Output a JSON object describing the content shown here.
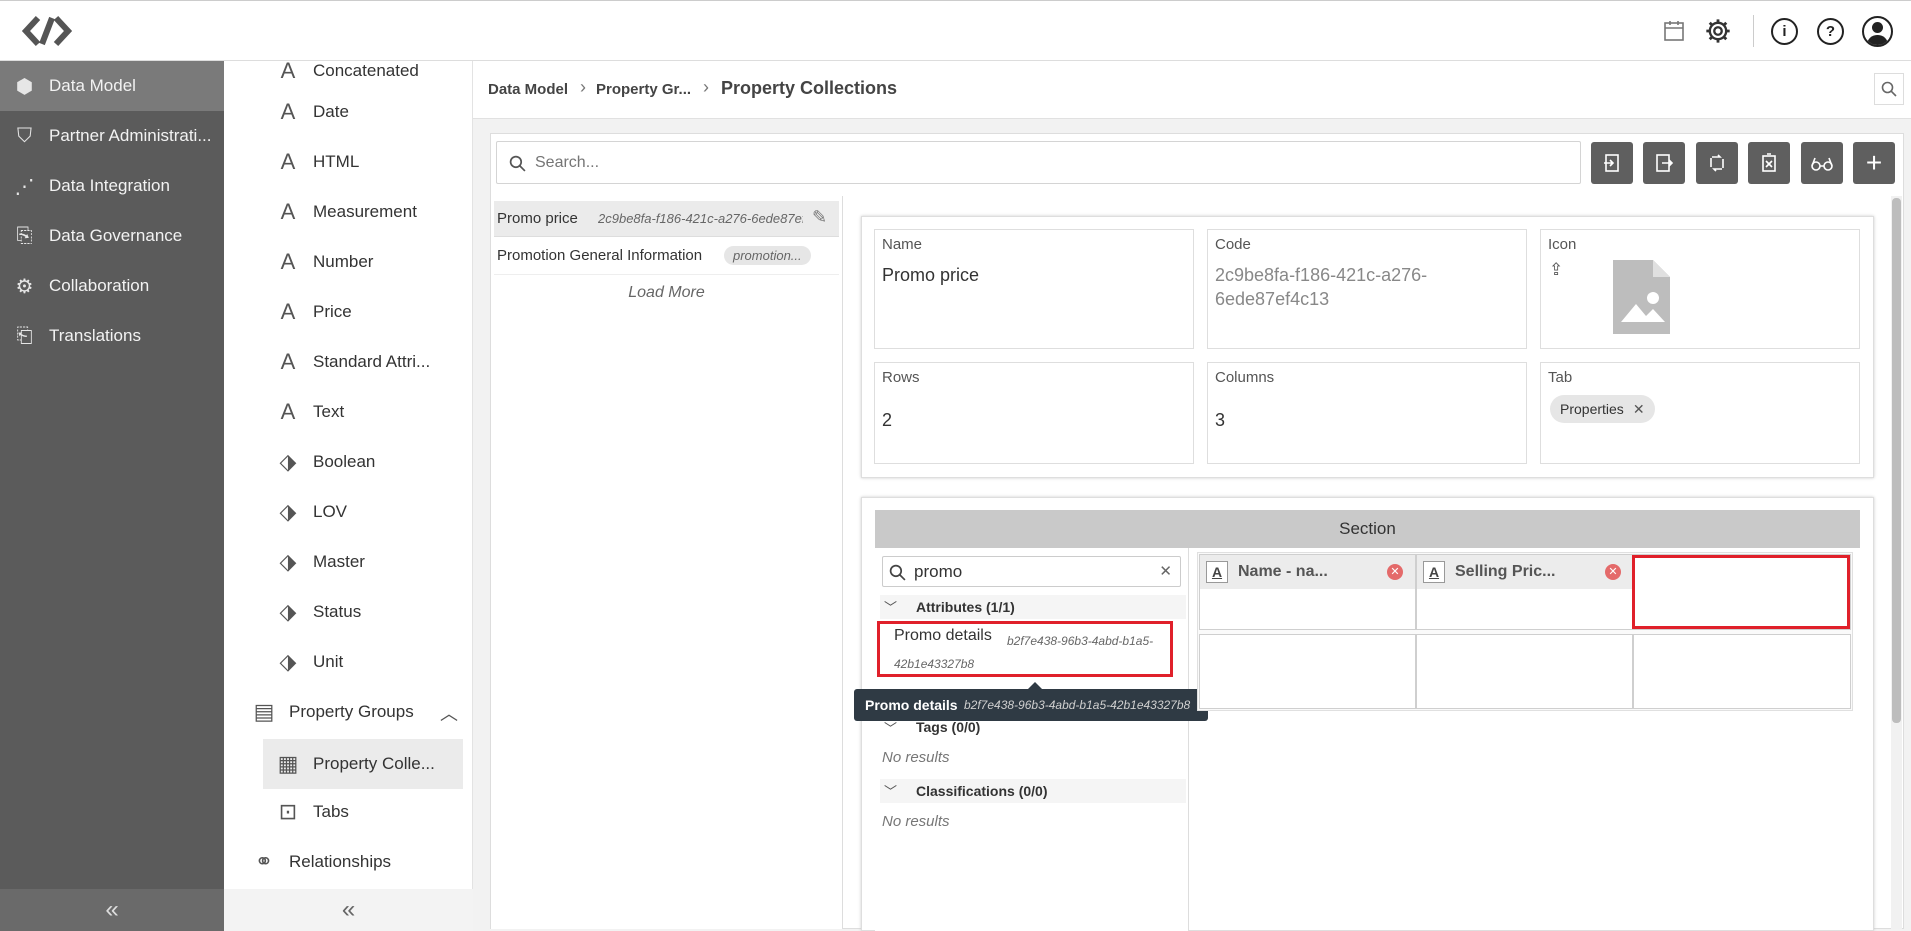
{
  "topbar": {
    "icons": [
      "logo-icon",
      "calendar-icon",
      "gear-icon",
      "info-icon",
      "help-icon",
      "user-icon"
    ]
  },
  "leftnav": {
    "items": [
      {
        "label": "Data Model",
        "icon": "data-model-icon"
      },
      {
        "label": "Partner Administrati...",
        "icon": "shield-icon"
      },
      {
        "label": "Data Integration",
        "icon": "integration-icon"
      },
      {
        "label": "Data Governance",
        "icon": "governance-icon"
      },
      {
        "label": "Collaboration",
        "icon": "collaboration-icon"
      },
      {
        "label": "Translations",
        "icon": "translations-icon"
      }
    ],
    "collapse": "«"
  },
  "subnav": {
    "items": [
      {
        "label": "Concatenated",
        "icon": "A"
      },
      {
        "label": "Date",
        "icon": "A"
      },
      {
        "label": "HTML",
        "icon": "A"
      },
      {
        "label": "Measurement",
        "icon": "A"
      },
      {
        "label": "Number",
        "icon": "A"
      },
      {
        "label": "Price",
        "icon": "A"
      },
      {
        "label": "Standard Attri...",
        "icon": "A"
      },
      {
        "label": "Text",
        "icon": "A"
      },
      {
        "label": "Boolean",
        "icon": "tag"
      },
      {
        "label": "LOV",
        "icon": "tag"
      },
      {
        "label": "Master",
        "icon": "tag"
      },
      {
        "label": "Status",
        "icon": "tag"
      },
      {
        "label": "Unit",
        "icon": "tag"
      }
    ],
    "group": {
      "label": "Property Groups",
      "expand_icon": "︿"
    },
    "group_items": [
      {
        "label": "Property Colle..."
      },
      {
        "label": "Tabs"
      }
    ],
    "relationships": "Relationships",
    "collapse": "«"
  },
  "breadcrumb": {
    "items": [
      "Data Model",
      "Property Gr...",
      "Property Collections"
    ],
    "sep": "›"
  },
  "search": {
    "placeholder": "Search...",
    "value": ""
  },
  "toolbar": [
    "import-icon",
    "export-icon",
    "sync-icon",
    "delete-icon",
    "glasses-icon",
    "add-icon"
  ],
  "list": {
    "items": [
      {
        "name": "Promo price",
        "code": "2c9be8fa-f186-421c-a276-6ede87ef..."
      },
      {
        "name": "Promotion General Information",
        "code": "promotion..."
      }
    ],
    "load_more": "Load More"
  },
  "detail": {
    "name_label": "Name",
    "name_value": "Promo price",
    "code_label": "Code",
    "code_value": "2c9be8fa-f186-421c-a276-6ede87ef4c13",
    "icon_label": "Icon",
    "rows_label": "Rows",
    "rows_value": "2",
    "columns_label": "Columns",
    "columns_value": "3",
    "tab_label": "Tab",
    "tab_chip": "Properties"
  },
  "section": {
    "title": "Section",
    "filter_value": "promo",
    "attributes_header": "Attributes (1/1)",
    "attribute_item": {
      "name": "Promo details",
      "code": "b2f7e438-96b3-4abd-b1a5-42b1e43327b8"
    },
    "tags_header": "Tags (0/0)",
    "tags_empty": "No results",
    "classifications_header": "Classifications (0/0)",
    "classifications_empty": "No results",
    "tooltip": {
      "name": "Promo details",
      "code": "b2f7e438-96b3-4abd-b1a5-42b1e43327b8"
    },
    "grid_cells": [
      {
        "label": "Name - na..."
      },
      {
        "label": "Selling Pric..."
      }
    ]
  }
}
